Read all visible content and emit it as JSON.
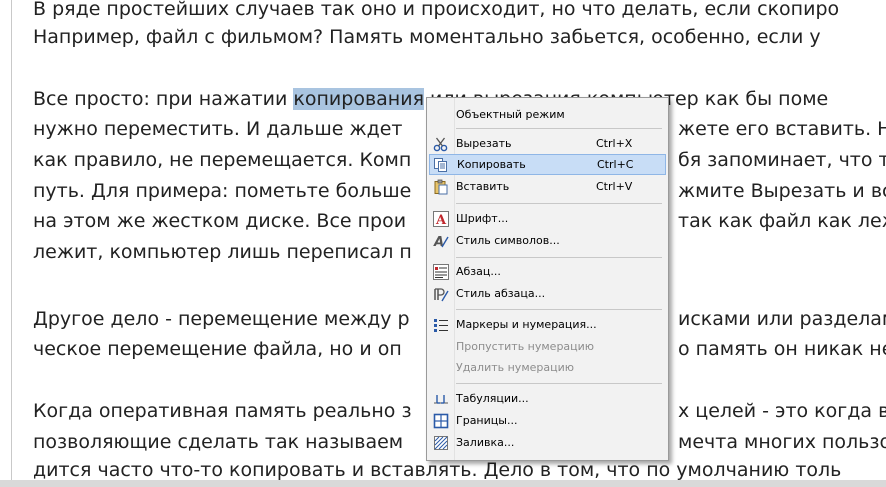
{
  "document": {
    "lines": [
      "В ряде простейших случаев так оно и происходит, но что делать, если скопиро",
      "Например, файл с фильмом? Память моментально забьется, особенно, если у",
      "",
      "Все просто: при нажатии ",
      "копирования",
      " или вырезания компьютер как бы поме",
      "нужно переместить. И дальше ждет",
      "жете его вставить. Н",
      "как правило, не перемещается. Комп",
      "бя запоминает, что те",
      "путь. Для примера: пометьте больше",
      "жмите Вырезать и вст",
      "на этом же жестком диске. Все прои",
      " так как файл как леж",
      "лежит, компьютер лишь переписал п",
      "Другое дело - перемещение между р",
      "исками или разделам",
      "ческое перемещение файла, но и оп",
      "о память он никак не",
      "Когда оперативная память реально з",
      "х целей - это когда вы",
      "позволяющие сделать так называем",
      "мечта многих пользо",
      "дится часто что-то копировать и вставлять. Дело в том, что по умолчанию толь"
    ]
  },
  "context_menu": {
    "items": [
      {
        "label": "Объектный режим",
        "shortcut": "",
        "icon": "none",
        "disabled": false,
        "highlighted": false
      },
      {
        "label": "Вырезать",
        "shortcut": "Ctrl+X",
        "icon": "scissors-icon",
        "disabled": false,
        "highlighted": false
      },
      {
        "label": "Копировать",
        "shortcut": "Ctrl+C",
        "icon": "copy-icon",
        "disabled": false,
        "highlighted": true
      },
      {
        "label": "Вставить",
        "shortcut": "Ctrl+V",
        "icon": "paste-icon",
        "disabled": false,
        "highlighted": false
      },
      {
        "label": "Шрифт...",
        "shortcut": "",
        "icon": "font-icon",
        "disabled": false,
        "highlighted": false
      },
      {
        "label": "Стиль символов...",
        "shortcut": "",
        "icon": "character-style-icon",
        "disabled": false,
        "highlighted": false
      },
      {
        "label": "Абзац...",
        "shortcut": "",
        "icon": "paragraph-icon",
        "disabled": false,
        "highlighted": false
      },
      {
        "label": "Стиль абзаца...",
        "shortcut": "",
        "icon": "paragraph-style-icon",
        "disabled": false,
        "highlighted": false
      },
      {
        "label": "Маркеры и нумерация...",
        "shortcut": "",
        "icon": "bullets-numbering-icon",
        "disabled": false,
        "highlighted": false
      },
      {
        "label": "Пропустить нумерацию",
        "shortcut": "",
        "icon": "none",
        "disabled": true,
        "highlighted": false
      },
      {
        "label": "Удалить нумерацию",
        "shortcut": "",
        "icon": "none",
        "disabled": true,
        "highlighted": false
      },
      {
        "label": "Табуляции...",
        "shortcut": "",
        "icon": "tabs-icon",
        "disabled": false,
        "highlighted": false
      },
      {
        "label": "Границы...",
        "shortcut": "",
        "icon": "borders-icon",
        "disabled": false,
        "highlighted": false
      },
      {
        "label": "Заливка...",
        "shortcut": "",
        "icon": "fill-icon",
        "disabled": false,
        "highlighted": false
      }
    ]
  },
  "colors": {
    "selection": "#a9c4e0",
    "menu_highlight": "#c8ddf6",
    "menu_background": "#f2f2f2",
    "disabled_text": "#8d8d8d"
  }
}
